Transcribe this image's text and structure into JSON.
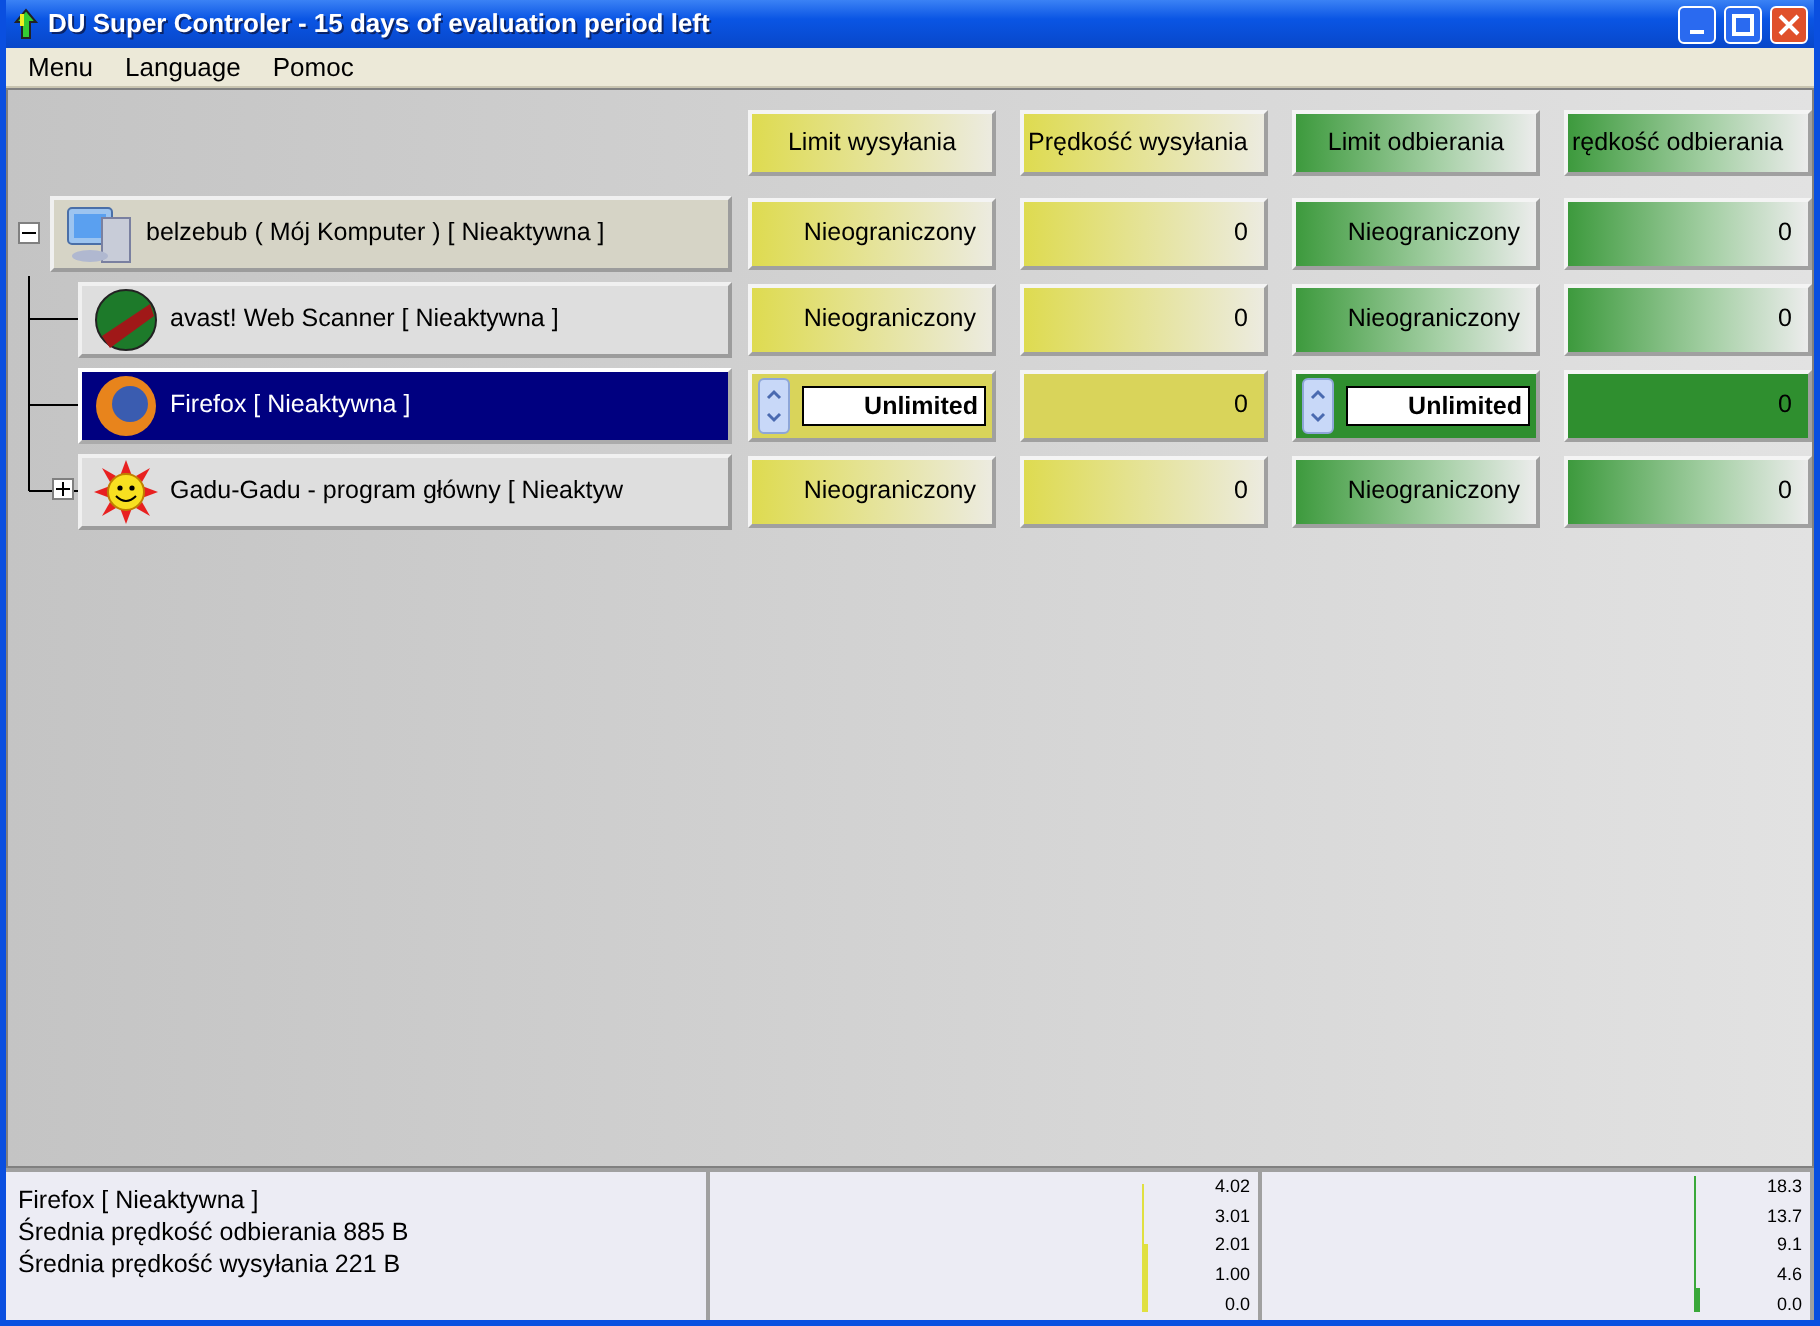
{
  "window": {
    "title": "DU Super Controler - 15 days of evaluation period left"
  },
  "menu": [
    "Menu",
    "Language",
    "Pomoc"
  ],
  "columns": [
    {
      "label": "Limit wysyłania",
      "kind": "upload"
    },
    {
      "label": "Prędkość wysyłania",
      "kind": "upload"
    },
    {
      "label": "Limit odbierania",
      "kind": "download"
    },
    {
      "label": "rędkość odbierania",
      "kind": "download"
    }
  ],
  "tree": {
    "label": "belzebub ( Mój Komputer ) [ Nieaktywna ]",
    "expanded": true,
    "selected": false,
    "cells": [
      {
        "kind": "text",
        "text": "Nieograniczony"
      },
      {
        "kind": "text",
        "text": "0"
      },
      {
        "kind": "text",
        "text": "Nieograniczony"
      },
      {
        "kind": "text",
        "text": "0"
      }
    ],
    "children": [
      {
        "label": "avast! Web Scanner  [ Nieaktywna ]",
        "selected": false,
        "cells": [
          {
            "kind": "text",
            "text": "Nieograniczony"
          },
          {
            "kind": "text",
            "text": "0"
          },
          {
            "kind": "text",
            "text": "Nieograniczony"
          },
          {
            "kind": "text",
            "text": "0"
          }
        ]
      },
      {
        "label": "Firefox  [ Nieaktywna ]",
        "selected": true,
        "cells": [
          {
            "kind": "spin",
            "text": "Unlimited"
          },
          {
            "kind": "text",
            "text": "0"
          },
          {
            "kind": "spin",
            "text": "Unlimited"
          },
          {
            "kind": "text",
            "text": "0"
          }
        ]
      },
      {
        "label": "Gadu-Gadu - program główny  [ Nieaktyw",
        "expanded": false,
        "selected": false,
        "cells": [
          {
            "kind": "text",
            "text": "Nieograniczony"
          },
          {
            "kind": "text",
            "text": "0"
          },
          {
            "kind": "text",
            "text": "Nieograniczony"
          },
          {
            "kind": "text",
            "text": "0"
          }
        ]
      }
    ]
  },
  "status": {
    "lines": [
      "Firefox  [ Nieaktywna ]",
      "Średnia prędkość odbierania 885  B",
      "Średnia prędkość wysyłania 221  B"
    ]
  },
  "graphs": [
    {
      "color": "#e0e040",
      "scale_labels": [
        "4.02",
        "3.01",
        "2.01",
        "1.00",
        "0.0"
      ]
    },
    {
      "color": "#3aa83a",
      "scale_labels": [
        "18.3",
        "13.7",
        "9.1",
        "4.6",
        "0.0"
      ]
    }
  ]
}
